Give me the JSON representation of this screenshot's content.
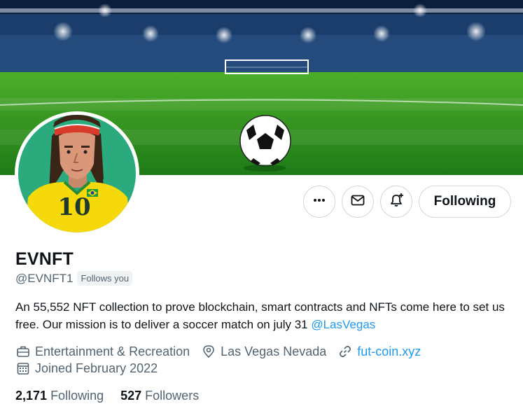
{
  "profile": {
    "display_name": "EVNFT",
    "handle": "@EVNFT1",
    "follows_you": "Follows you",
    "bio_text": "An 55,552 NFT collection to prove blockchain, smart contracts and NFTs come here to set us free. Our mission is to deliver a soccer match on july 31 ",
    "bio_mention": "@LasVegas",
    "category": "Entertainment & Recreation",
    "location": "Las Vegas Nevada",
    "website": "fut-coin.xyz",
    "joined": "Joined February 2022",
    "avatar_jersey_number": "10"
  },
  "actions": {
    "more_icon": "more-dots-icon",
    "message_icon": "mail-icon",
    "notify_icon": "bell-plus-icon",
    "following_label": "Following"
  },
  "stats": {
    "following_count": "2,171",
    "following_label": "Following",
    "followers_count": "527",
    "followers_label": "Followers"
  },
  "colors": {
    "accent": "#1d9bf0",
    "text_primary": "#0f1419",
    "text_secondary": "#536471",
    "border": "#cfd9de",
    "avatar_bg": "#2bab7d",
    "jersey_yellow": "#f5d90a"
  }
}
